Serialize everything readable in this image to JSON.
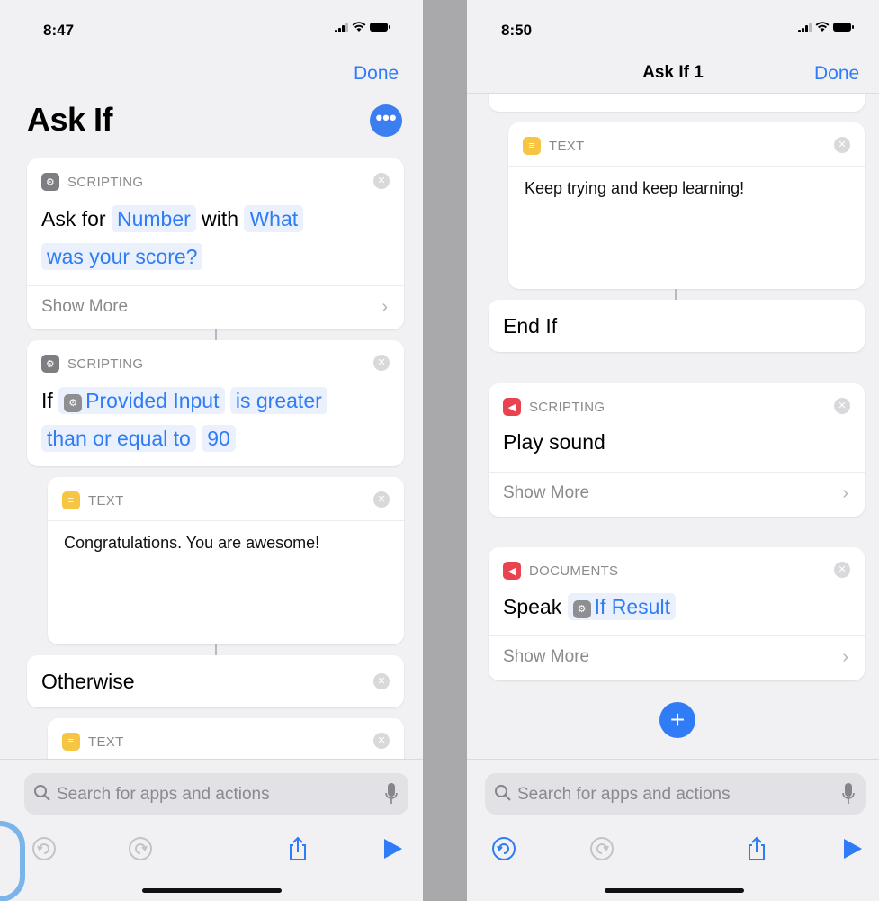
{
  "left": {
    "time": "8:47",
    "done": "Done",
    "title": "Ask If",
    "more": "•••",
    "card1": {
      "category": "SCRIPTING",
      "ask_for": "Ask for",
      "type_token": "Number",
      "with": "with",
      "prompt_token_a": "What",
      "prompt_token_b": "was your score?",
      "show_more": "Show More"
    },
    "card2": {
      "category": "SCRIPTING",
      "if_word": "If",
      "input_token": "Provided Input",
      "cond_token_a": "is greater",
      "cond_token_b": "than or equal to",
      "value_token": "90"
    },
    "card3": {
      "category": "TEXT",
      "text": "Congratulations.  You are awesome!"
    },
    "otherwise": "Otherwise",
    "card4": {
      "category": "TEXT"
    },
    "search_placeholder": "Search for apps and actions"
  },
  "right": {
    "time": "8:50",
    "nav_title": "Ask If 1",
    "done": "Done",
    "text_card": {
      "category": "TEXT",
      "text": "Keep trying and keep learning!"
    },
    "end_if": "End If",
    "play_card": {
      "category": "SCRIPTING",
      "title": "Play sound",
      "show_more": "Show More"
    },
    "speak_card": {
      "category": "DOCUMENTS",
      "speak": "Speak",
      "token": "If Result",
      "show_more": "Show More"
    },
    "add": "+",
    "search_placeholder": "Search for apps and actions"
  },
  "colors": {
    "accent": "#2f7cf6",
    "text_yellow": "#f7c544",
    "sound_red": "#e8434f"
  }
}
